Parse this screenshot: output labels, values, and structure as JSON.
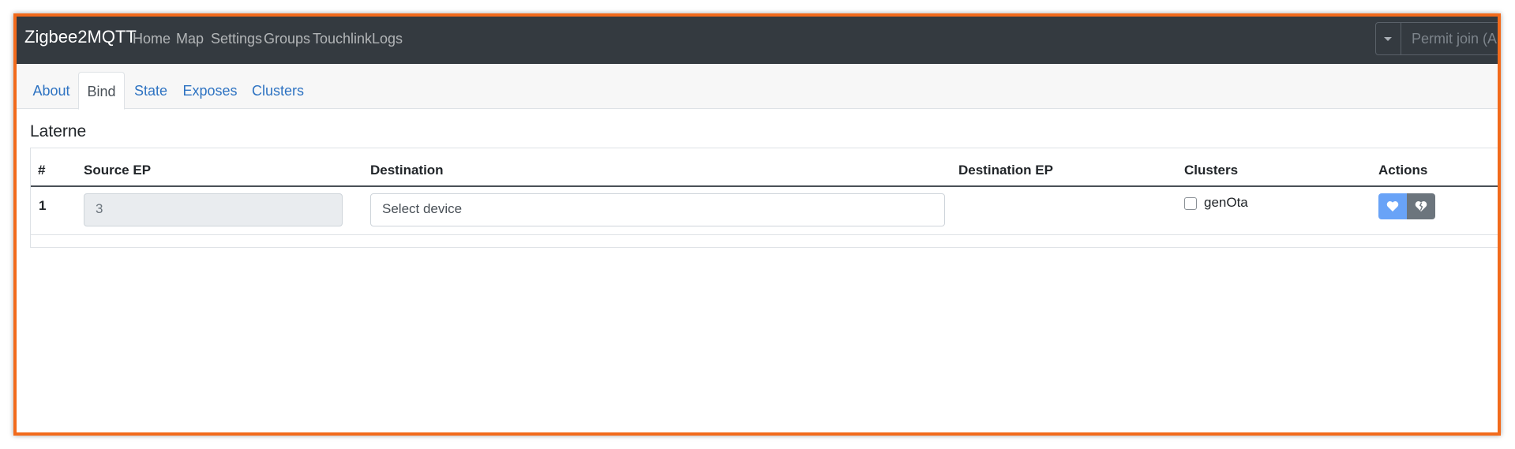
{
  "navbar": {
    "brand": "Zigbee2MQTT",
    "links": [
      "Home",
      "Map",
      "Settings",
      "Groups",
      "Touchlink",
      "Logs"
    ],
    "permit_join_label": "Permit join (All)"
  },
  "tabs": [
    "About",
    "Bind",
    "State",
    "Exposes",
    "Clusters"
  ],
  "active_tab": "Bind",
  "device_name": "Laterne",
  "table": {
    "headers": [
      "#",
      "Source EP",
      "Destination",
      "Destination EP",
      "Clusters",
      "Actions"
    ],
    "rows": [
      {
        "num": "1",
        "source_ep": "3",
        "destination_placeholder": "Select device",
        "destination_ep": "",
        "clusters": [
          {
            "label": "genOta",
            "checked": false
          }
        ]
      }
    ]
  },
  "colors": {
    "frame": "#f26a1b",
    "navbar": "#343a40",
    "link": "#2e73c2",
    "bind_button": "#69a3f7",
    "unbind_button": "#6c757d"
  },
  "icons": [
    "heart-icon",
    "broken-heart-icon",
    "chevron-down-icon"
  ]
}
